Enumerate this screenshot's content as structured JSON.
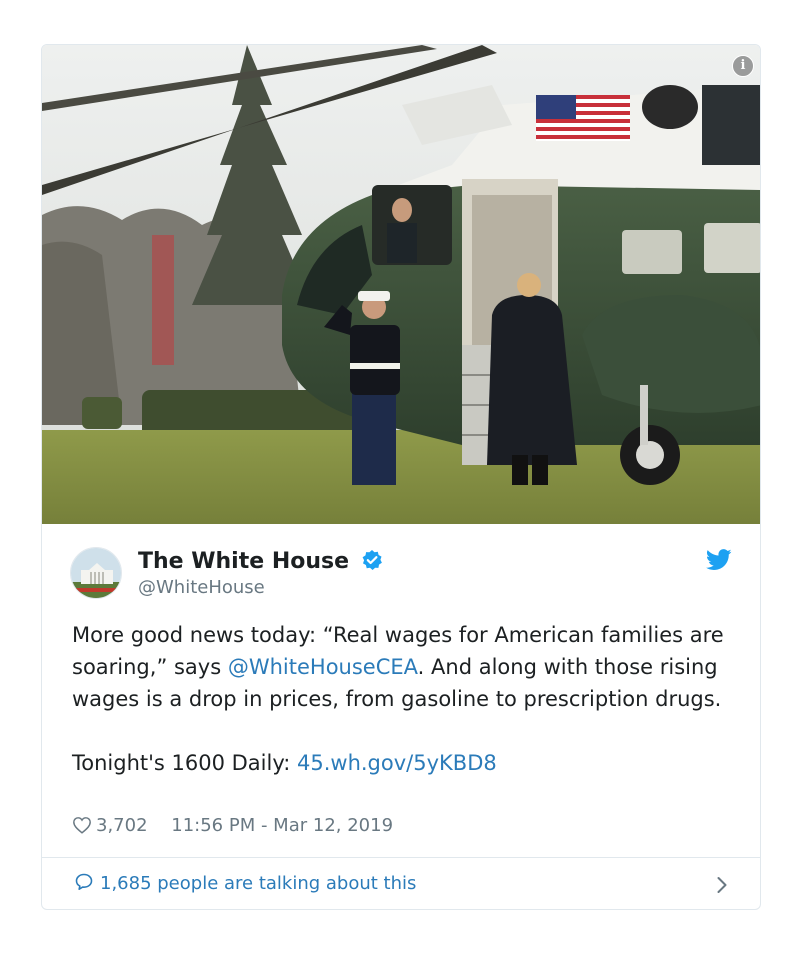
{
  "tweet": {
    "display_name": "The White House",
    "handle": "@WhiteHouse",
    "text_before_mention": "More good news today: “Real wages for American families are soaring,” says ",
    "mention": "@WhiteHouseCEA",
    "text_after_mention": ". And along with those rising wages is a drop in prices, from gasoline to prescription drugs.",
    "second_line_prefix": "Tonight's 1600 Daily: ",
    "link": "45.wh.gov/5yKBD8",
    "like_count": "3,702",
    "timestamp": "11:56 PM - Mar 12, 2019",
    "talking": "1,685 people are talking about this"
  },
  "icons": {
    "info": "info-icon",
    "verified": "verified-badge-icon",
    "brand": "twitter-bird-icon",
    "like": "heart-icon",
    "reply": "speech-bubble-icon",
    "more": "chevron-right-icon"
  },
  "colors": {
    "text": "#1c2022",
    "secondary": "#697882",
    "link": "#2b7bb9",
    "twitter_blue": "#1da1f2",
    "border": "#e1e8ed"
  }
}
